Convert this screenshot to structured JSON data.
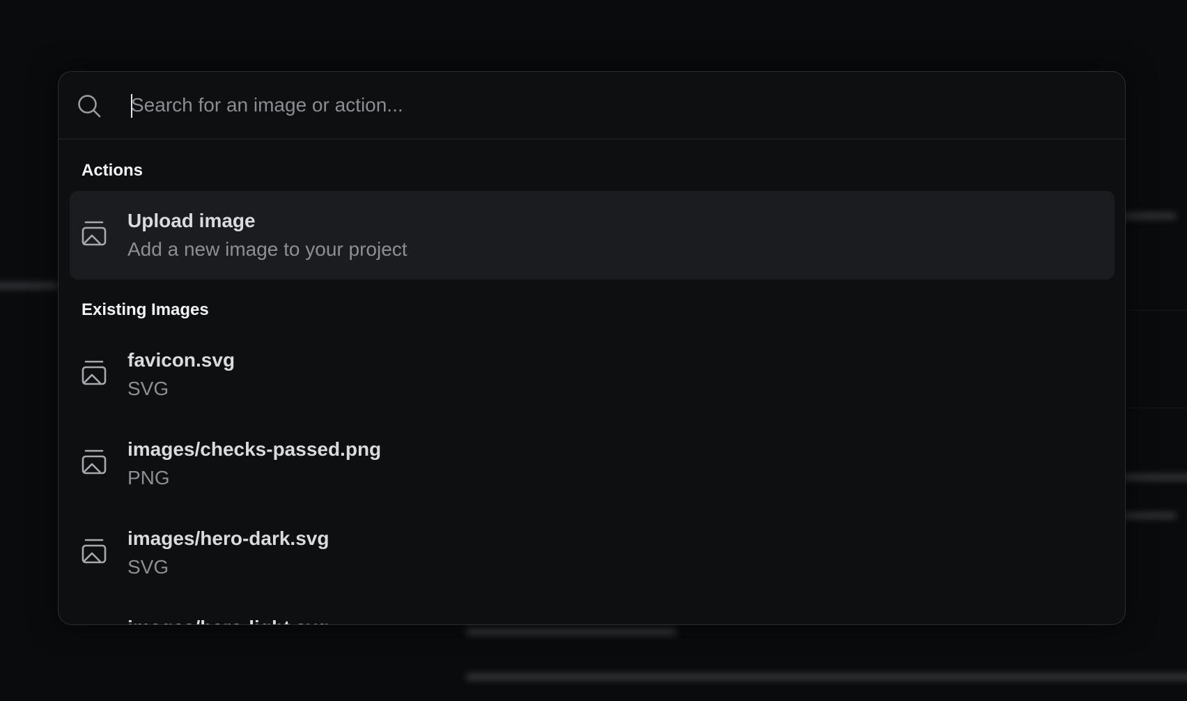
{
  "search": {
    "placeholder": "Search for an image or action...",
    "value": ""
  },
  "sections": {
    "actions": {
      "heading": "Actions",
      "items": [
        {
          "title": "Upload image",
          "subtitle": "Add a new image to your project",
          "icon": "image-icon"
        }
      ]
    },
    "existing": {
      "heading": "Existing Images",
      "items": [
        {
          "title": "favicon.svg",
          "subtitle": "SVG",
          "icon": "image-icon"
        },
        {
          "title": "images/checks-passed.png",
          "subtitle": "PNG",
          "icon": "image-icon"
        },
        {
          "title": "images/hero-dark.svg",
          "subtitle": "SVG",
          "icon": "image-icon"
        },
        {
          "title": "images/hero-light.svg",
          "subtitle": "",
          "icon": "image-icon"
        }
      ]
    }
  },
  "colors": {
    "background": "#0a0b0d",
    "panel": "#0e0f11",
    "selected_row": "#1b1c1f",
    "border": "#2c2e31"
  }
}
